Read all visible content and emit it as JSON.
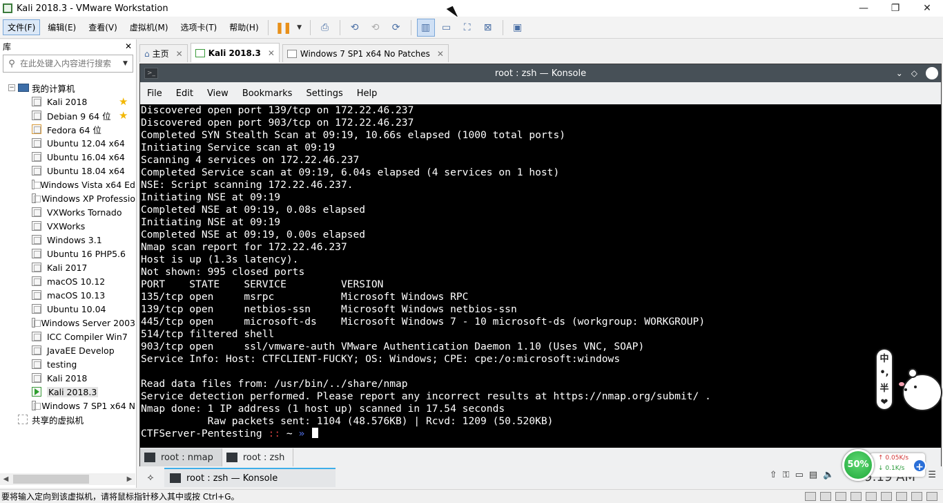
{
  "window": {
    "title": "Kali 2018.3 - VMware Workstation",
    "controls": {
      "minimize": "—",
      "restore": "❐",
      "close": "✕"
    }
  },
  "menu": {
    "file": "文件(F)",
    "edit": "编辑(E)",
    "view": "查看(V)",
    "vm": "虚拟机(M)",
    "tabs": "选项卡(T)",
    "help": "帮助(H)"
  },
  "library": {
    "title": "库",
    "close": "✕",
    "search_placeholder": "在此处键入内容进行搜索",
    "root": "我的计算机",
    "shared": "共享的虚拟机",
    "items": [
      {
        "label": "Kali 2018",
        "star": true
      },
      {
        "label": "Debian 9 64 位",
        "star": true
      },
      {
        "label": "Fedora 64 位"
      },
      {
        "label": "Ubuntu 12.04 x64"
      },
      {
        "label": "Ubuntu 16.04 x64"
      },
      {
        "label": "Ubuntu 18.04 x64"
      },
      {
        "label": "Windows Vista x64 Ed"
      },
      {
        "label": "Windows XP Professio"
      },
      {
        "label": "VXWorks Tornado"
      },
      {
        "label": "VXWorks"
      },
      {
        "label": "Windows 3.1"
      },
      {
        "label": "Ubuntu 16 PHP5.6"
      },
      {
        "label": "Kali 2017"
      },
      {
        "label": "macOS 10.12"
      },
      {
        "label": "macOS 10.13"
      },
      {
        "label": "Ubuntu 10.04"
      },
      {
        "label": "Windows Server 2003"
      },
      {
        "label": "ICC Compiler Win7"
      },
      {
        "label": "JavaEE Develop"
      },
      {
        "label": "testing"
      },
      {
        "label": "Kali 2018"
      },
      {
        "label": "Kali 2018.3",
        "selected": true
      },
      {
        "label": "Windows 7 SP1 x64 N"
      }
    ]
  },
  "tabs": [
    {
      "label": "主页"
    },
    {
      "label": "Kali 2018.3",
      "active": true
    },
    {
      "label": "Windows 7 SP1 x64 No Patches"
    }
  ],
  "konsole": {
    "title": "root : zsh — Konsole",
    "menu": [
      "File",
      "Edit",
      "View",
      "Bookmarks",
      "Settings",
      "Help"
    ],
    "lines": [
      "Discovered open port 139/tcp on 172.22.46.237",
      "Discovered open port 903/tcp on 172.22.46.237",
      "Completed SYN Stealth Scan at 09:19, 10.66s elapsed (1000 total ports)",
      "Initiating Service scan at 09:19",
      "Scanning 4 services on 172.22.46.237",
      "Completed Service scan at 09:19, 6.04s elapsed (4 services on 1 host)",
      "NSE: Script scanning 172.22.46.237.",
      "Initiating NSE at 09:19",
      "Completed NSE at 09:19, 0.08s elapsed",
      "Initiating NSE at 09:19",
      "Completed NSE at 09:19, 0.00s elapsed",
      "Nmap scan report for 172.22.46.237",
      "Host is up (1.3s latency).",
      "Not shown: 995 closed ports",
      "PORT    STATE    SERVICE         VERSION",
      "135/tcp open     msrpc           Microsoft Windows RPC",
      "139/tcp open     netbios-ssn     Microsoft Windows netbios-ssn",
      "445/tcp open     microsoft-ds    Microsoft Windows 7 - 10 microsoft-ds (workgroup: WORKGROUP)",
      "514/tcp filtered shell",
      "903/tcp open     ssl/vmware-auth VMware Authentication Daemon 1.10 (Uses VNC, SOAP)",
      "Service Info: Host: CTFCLIENT-FUCKY; OS: Windows; CPE: cpe:/o:microsoft:windows",
      "",
      "Read data files from: /usr/bin/../share/nmap",
      "Service detection performed. Please report any incorrect results at https://nmap.org/submit/ .",
      "Nmap done: 1 IP address (1 host up) scanned in 17.54 seconds",
      "           Raw packets sent: 1104 (48.576KB) | Rcvd: 1209 (50.520KB)"
    ],
    "prompt": {
      "host": "CTFServer-Pentesting",
      "sep": "::",
      "dir": "~",
      "arrow": "»"
    },
    "session_tabs": [
      "root : nmap",
      "root : zsh"
    ]
  },
  "side_widget": [
    "中",
    "•,",
    "半",
    "❤"
  ],
  "taskbar": {
    "task": "root : zsh — Konsole",
    "clock": "9:19 AM"
  },
  "net_widget": {
    "percent": "50%",
    "up": "0.05K/s",
    "down": "0.1K/s"
  },
  "status": {
    "text": "要将输入定向到该虚拟机，请将鼠标指针移入其中或按 Ctrl+G。"
  }
}
